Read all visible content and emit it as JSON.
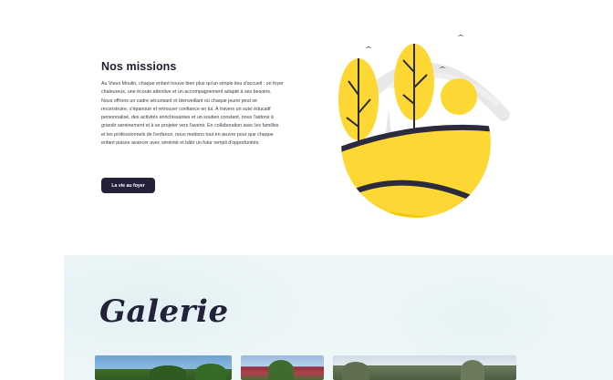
{
  "missions": {
    "title": "Nos missions",
    "paragraph": "Au Vieux Moulin, chaque enfant trouve bien plus qu'un simple lieu d'accueil : un foyer chaleureux, une écoute attentive et un accompagnement adapté à ses besoins. Nous offrons un cadre sécurisant et bienveillant où chaque jeune peut se reconstruire, s'épanouir et retrouver confiance en lui. À travers un suivi éducatif personnalisé, des activités enrichissantes et un soutien constant, nous l'aidons à grandir sereinement et à se projeter vers l'avenir. En collaboration avec les familles et les professionnels de l'enfance, nous mettons tout en œuvre pour que chaque enfant puisse avancer avec sérénité et bâtir un futur rempli d'opportunités.",
    "button_label": "La vie au foyer"
  },
  "gallery": {
    "title": "Galerie"
  },
  "colors": {
    "accent_yellow": "#fdd835",
    "dark_navy": "#24223a",
    "gallery_bg": "#eef7f8"
  }
}
